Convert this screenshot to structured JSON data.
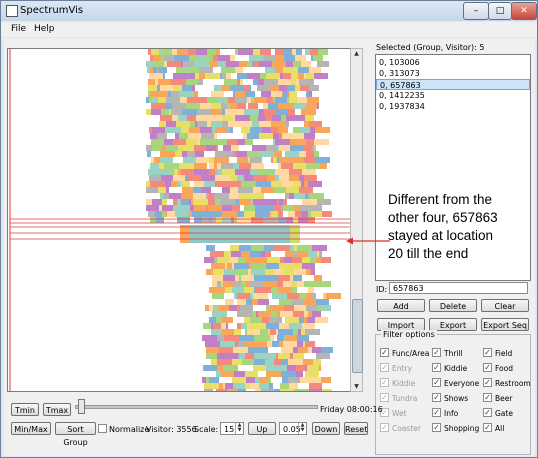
{
  "window": {
    "title": "SpectrumVis",
    "minimize_label": "–",
    "maximize_label": "□",
    "close_label": "✕",
    "app_icon": "app-window-icon"
  },
  "menu": [
    "File",
    "Help"
  ],
  "selection": {
    "label": "Selected (Group, Visitor):  5",
    "items": [
      "0, 103006",
      "0, 313073",
      "0, 657863",
      "0, 1412235",
      "0, 1937834"
    ],
    "selected_index": 2
  },
  "id_field": {
    "label": "ID:",
    "value": "657863"
  },
  "buttons_row1": [
    "Add",
    "Delete",
    "Clear"
  ],
  "buttons_row2": [
    "Import",
    "Export",
    "Export Seq"
  ],
  "filter": {
    "title": "Filter options",
    "columns": [
      [
        {
          "label": "Func/Area",
          "checked": true,
          "enabled": true
        },
        {
          "label": "Entry",
          "checked": true,
          "enabled": false
        },
        {
          "label": "Kiddie",
          "checked": true,
          "enabled": false
        },
        {
          "label": "Tundra",
          "checked": true,
          "enabled": false
        },
        {
          "label": "Wet",
          "checked": true,
          "enabled": false
        },
        {
          "label": "Coaster",
          "checked": true,
          "enabled": false
        }
      ],
      [
        {
          "label": "Thrill",
          "checked": true,
          "enabled": true
        },
        {
          "label": "Kiddie",
          "checked": true,
          "enabled": true
        },
        {
          "label": "Everyone",
          "checked": true,
          "enabled": true
        },
        {
          "label": "Shows",
          "checked": true,
          "enabled": true
        },
        {
          "label": "Info",
          "checked": true,
          "enabled": true
        },
        {
          "label": "Shopping",
          "checked": true,
          "enabled": true
        }
      ],
      [
        {
          "label": "Field",
          "checked": true,
          "enabled": true
        },
        {
          "label": "Food",
          "checked": true,
          "enabled": true
        },
        {
          "label": "Restroom",
          "checked": true,
          "enabled": true
        },
        {
          "label": "Beer",
          "checked": true,
          "enabled": true
        },
        {
          "label": "Gate",
          "checked": true,
          "enabled": true
        },
        {
          "label": "All",
          "checked": true,
          "enabled": true
        }
      ]
    ]
  },
  "timeline": {
    "tmin_label": "Tmin",
    "tmax_label": "Tmax",
    "time_label": "Friday 08:00:16",
    "slider_fraction": 0.01
  },
  "bottom": {
    "minmax_label": "Min/Max",
    "sortgroup_label": "Sort Group",
    "normalize_label": "Normalize",
    "normalize_checked": false,
    "visitor_label": "Visitor:  3556",
    "scale_label": "Scale:",
    "scale_value": "15",
    "up_label": "Up",
    "step_value": "0.05",
    "down_label": "Down",
    "reset_label": "Reset"
  },
  "annotation": {
    "lines": [
      "Different from the",
      "other four, 657863",
      "stayed at location",
      "20 till the end"
    ],
    "color": "#000000",
    "arrow_color": "#e0302b"
  },
  "plot": {
    "highlight_color": "#e03a3a",
    "palette": [
      "#f9a55a",
      "#c07fc6",
      "#f48a7b",
      "#7fb0d7",
      "#a6d77c",
      "#e8e066",
      "#b5b5b5",
      "#ffd9a0",
      "#9ad3c2",
      "#ffffff"
    ]
  }
}
